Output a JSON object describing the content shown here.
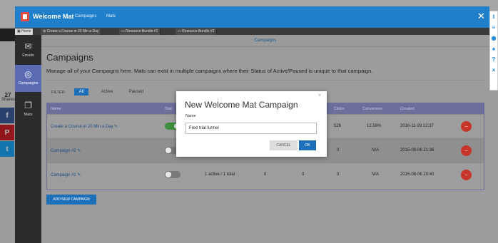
{
  "app": {
    "title": "Welcome Mat",
    "nav": [
      "Campaigns",
      "Mats"
    ]
  },
  "tabs": [
    "Home",
    "Create a Course in 20 Min a Day",
    "Resource Bundle #1",
    "Resource Bundle #2"
  ],
  "sidebar": {
    "items": [
      {
        "label": "Emails",
        "icon": "envelope-icon"
      },
      {
        "label": "Campaigns",
        "icon": "target-icon"
      },
      {
        "label": "Mats",
        "icon": "layers-icon"
      }
    ]
  },
  "breadcrumb": "Campaigns",
  "page": {
    "title": "Campaigns",
    "description": "Manage all of your Campaigns here. Mats can exist in multiple campaigns where their Status of Active/Paused is unique to that campaign."
  },
  "filter": {
    "label": "FILTER:",
    "options": [
      "All",
      "Active",
      "Paused"
    ],
    "selected": "All"
  },
  "table": {
    "headers": [
      "Name",
      "Stat",
      "Clicks",
      "Conversion",
      "Created"
    ],
    "rows": [
      {
        "name": "Create a Course in 20 Min a Day",
        "active": true,
        "mats": "",
        "views": "",
        "subs": "",
        "clicks": "526",
        "conversion": "12.56%",
        "created": "2016-11-29 12:37"
      },
      {
        "name": "Campaign #2",
        "active": false,
        "mats": "",
        "views": "",
        "subs": "",
        "clicks": "0",
        "conversion": "N/A",
        "created": "2015-08-06 21:36"
      },
      {
        "name": "Campaign #1",
        "active": false,
        "mats": "1 active / 1 total",
        "views": "0",
        "subs": "0",
        "clicks": "0",
        "conversion": "N/A",
        "created": "2015-08-06 20:40"
      }
    ]
  },
  "add_button": "ADD NEW CAMPAIGN",
  "modal": {
    "title": "New Welcome Mat Campaign",
    "label": "Name",
    "value": "Free trial funnel",
    "cancel": "CANCEL",
    "ok": "OK",
    "close": "×"
  },
  "social": {
    "count": "27",
    "unit": "Shares"
  },
  "colors": {
    "brand": "#1f7fcb",
    "accent_red": "#c7352b",
    "sidebar_active": "#5a6bb4",
    "toggle_on": "#3d8e3d"
  }
}
